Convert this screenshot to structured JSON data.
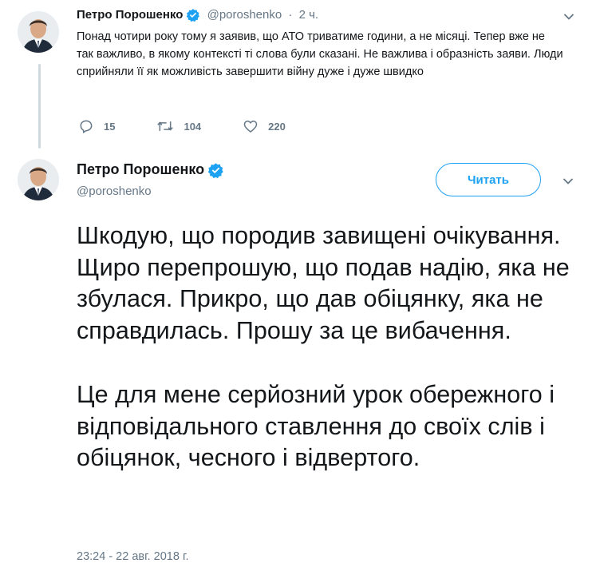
{
  "tweet1": {
    "name": "Петро Порошенко",
    "handle": "@poroshenko",
    "separator": "·",
    "time": "2 ч.",
    "text": "Понад чотири року тому я заявив, що АТО триватиме години, а не місяці. Тепер вже не так важливо, в якому контексті ті слова були сказані. Не важлива і образність заяви. Люди сприйняли її як можливість завершити війну дуже і дуже швидко",
    "replies": "15",
    "retweets": "104",
    "likes": "220"
  },
  "tweet2": {
    "name": "Петро Порошенко",
    "handle": "@poroshenko",
    "follow_label": "Читать",
    "paragraph1": "Шкодую, що породив завищені очікування. Щиро перепрошую, що подав надію, яка не збулася. Прикро, що дав обіцянку, яка не справдилась. Прошу за це вибачення.",
    "paragraph2": "Це для мене серйозний урок обережного і відповідального ставлення до своїх слів і обіцянок, чесного і відвертого.",
    "timestamp": "23:24 - 22 авг. 2018 г."
  },
  "icons": {
    "verified": "verified-badge-icon",
    "reply": "reply-icon",
    "retweet": "retweet-icon",
    "like": "heart-icon",
    "menu": "chevron-down-icon"
  },
  "colors": {
    "accent": "#1da1f2",
    "muted": "#657786",
    "text": "#14171a",
    "thread_line": "#cfd9de"
  }
}
